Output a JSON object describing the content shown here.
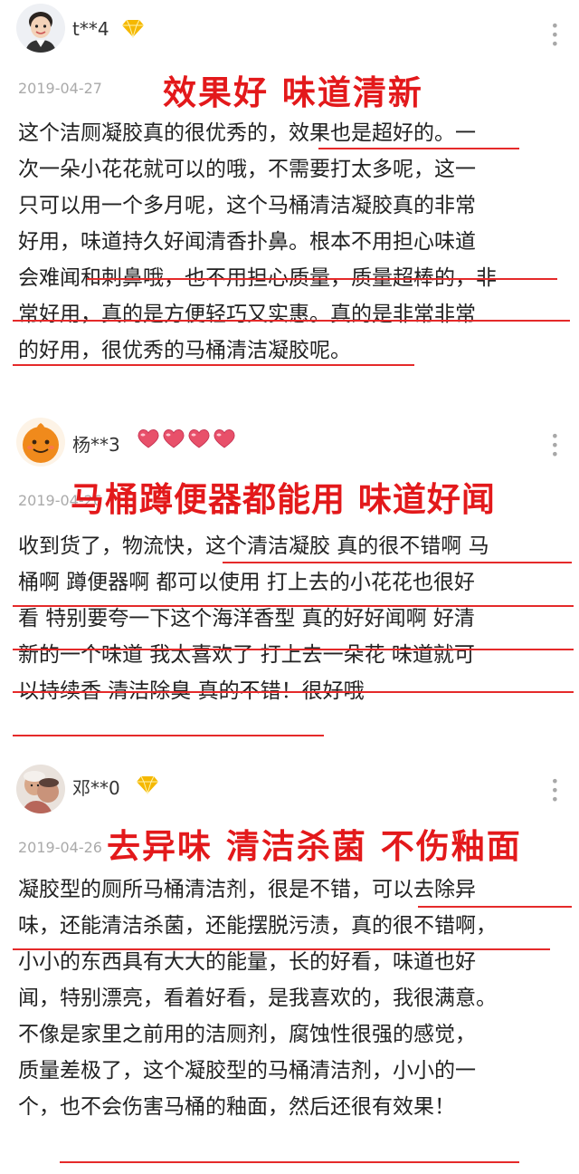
{
  "reviews": [
    {
      "username": "t**4",
      "date": "2019-04-27",
      "headline": "效果好 味道清新",
      "lines": [
        "这个洁厕凝胶真的很优秀的，效果也是超好的。一",
        "次一朵小花花就可以的哦，不需要打太多呢，这一",
        "只可以用一个多月呢，这个马桶清洁凝胶真的非常",
        "好用，味道持久好闻清香扑鼻。根本不用担心味道",
        "会难闻和刺鼻哦，也不用担心质量，质量超棒的，非",
        "常好用，真的是方便轻巧又实惠。真的是非常非常",
        "的好用，很优秀的马桶清洁凝胶呢。"
      ]
    },
    {
      "username": "杨**3",
      "date": "2019-04-26",
      "headline": "马桶蹲便器都能用 味道好闻",
      "lines": [
        "收到货了，物流快，这个清洁凝胶 真的很不错啊 马",
        "桶啊 蹲便器啊 都可以使用 打上去的小花花也很好",
        "看 特别要夸一下这个海洋香型 真的好好闻啊 好清",
        "新的一个味道 我太喜欢了 打上去一朵花 味道就可",
        "以持续香 清洁除臭 真的不错！很好哦"
      ]
    },
    {
      "username": "邓**0",
      "date": "2019-04-26",
      "headline": "去异味 清洁杀菌 不伤釉面",
      "lines": [
        "凝胶型的厕所马桶清洁剂，很是不错，可以去除异",
        "味，还能清洁杀菌，还能摆脱污渍，真的很不错啊，",
        "小小的东西具有大大的能量，长的好看，味道也好",
        "闻，特别漂亮，看着好看，是我喜欢的，我很满意。",
        "不像是家里之前用的洁厕剂，腐蚀性很强的感觉，",
        "质量差极了，这个凝胶型的马桶清洁剂，小小的一",
        "个，也不会伤害马桶的釉面，然后还很有效果！"
      ]
    }
  ],
  "icons": {
    "badge_icon": "diamond-icon",
    "heart_icon": "heart-icon",
    "more_icon": "more-dots-icon"
  },
  "colors": {
    "headline": "#e3191b",
    "underline": "#e52a2a",
    "diamond": "#f5b800",
    "heart": "#e8506a",
    "date": "#aaaaaa"
  }
}
